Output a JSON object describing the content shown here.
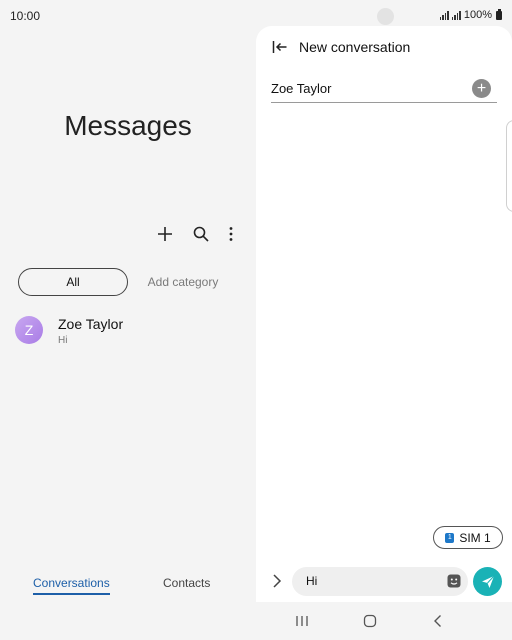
{
  "status_bar": {
    "time": "10:00",
    "battery": "100%"
  },
  "left_pane": {
    "title": "Messages",
    "toolbar": {
      "add_icon": "plus-icon",
      "search_icon": "search-icon",
      "more_icon": "more-vertical-icon"
    },
    "categories": {
      "all_label": "All",
      "add_label": "Add category"
    },
    "conversations": [
      {
        "avatar_initial": "Z",
        "name": "Zoe Taylor",
        "preview": "Hi"
      }
    ],
    "bottom_tabs": {
      "conversations_label": "Conversations",
      "contacts_label": "Contacts"
    }
  },
  "right_pane": {
    "header_title": "New conversation",
    "recipient_value": "Zoe Taylor",
    "sim_label": "SIM 1",
    "sim_badge": "1",
    "message_value": "Hi"
  },
  "colors": {
    "accent": "#1d5fa8",
    "send": "#1ab2b6",
    "avatar": "#b48ae9"
  }
}
